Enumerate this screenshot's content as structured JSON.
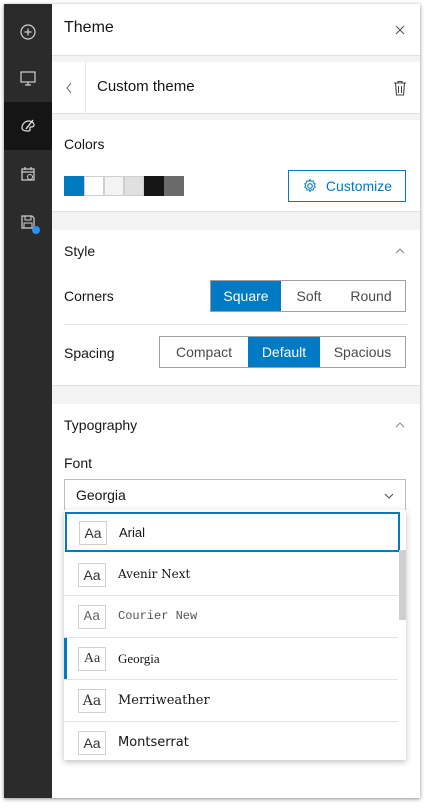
{
  "rail": {
    "items": [
      {
        "icon": "plus-circle-icon"
      },
      {
        "icon": "monitor-icon"
      },
      {
        "icon": "palette-icon",
        "active": true
      },
      {
        "icon": "calendar-icon"
      },
      {
        "icon": "save-icon",
        "badge": true
      }
    ]
  },
  "header": {
    "title": "Theme",
    "close_symbol": "×"
  },
  "subheader": {
    "title": "Custom theme"
  },
  "colors": {
    "label": "Colors",
    "swatches": [
      "#0079c1",
      "#ffffff",
      "#f3f3f3",
      "#e0e0e0",
      "#151515",
      "#6a6a6a"
    ],
    "customize_label": "Customize"
  },
  "style": {
    "label": "Style",
    "corners_label": "Corners",
    "corners_options": [
      "Square",
      "Soft",
      "Round"
    ],
    "corners_selected": "Square",
    "spacing_label": "Spacing",
    "spacing_options": [
      "Compact",
      "Default",
      "Spacious"
    ],
    "spacing_selected": "Default"
  },
  "typography": {
    "label": "Typography",
    "font_label": "Font",
    "font_value": "Georgia",
    "options": [
      {
        "preview": "Aa",
        "name": "Arial"
      },
      {
        "preview": "Aa",
        "name": "Avenir Next"
      },
      {
        "preview": "Aa",
        "name": "Courier New"
      },
      {
        "preview": "Aa",
        "name": "Georgia"
      },
      {
        "preview": "Aa",
        "name": "Merriweather"
      },
      {
        "preview": "Aa",
        "name": "Montserrat"
      }
    ]
  },
  "accent_color": "#007ac2"
}
